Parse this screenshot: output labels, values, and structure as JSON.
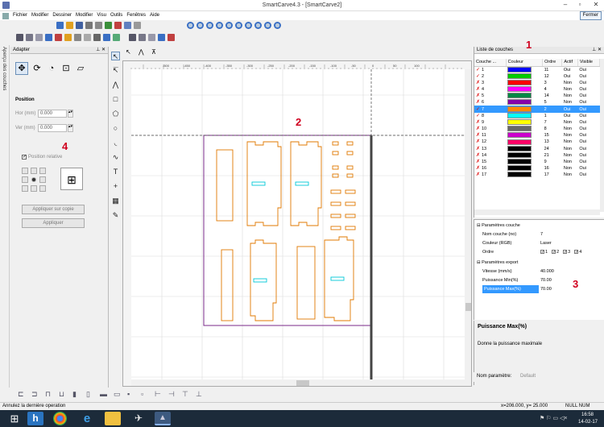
{
  "window": {
    "title": "SmartCarve4.3 - [SmartCarve2]",
    "close_label": "Fermer"
  },
  "menu": [
    "Fichier",
    "Modifier",
    "Dessiner",
    "Modifier",
    "Visu",
    "Outils",
    "Fenêtres",
    "Aide"
  ],
  "side_tab": "Aperçu des couches",
  "adapter": {
    "title": "Adapter",
    "section_position": "Position",
    "x_label": "Hor (mm)",
    "x_value": "0.000",
    "y_label": "Ver (mm)",
    "y_value": "0.000",
    "relative_label": "Position relative",
    "apply_copy_label": "Appliquer sur copie",
    "apply_label": "Appliquer"
  },
  "layers": {
    "title": "Liste de couches",
    "headers": [
      "Couche ...",
      "Couleur",
      "Ordre",
      "Actif",
      "Visible"
    ],
    "rows": [
      {
        "mark": "✓",
        "num": "1",
        "color": "#0000ff",
        "order": "11",
        "active": "Oui",
        "visible": "Oui"
      },
      {
        "mark": "✓",
        "num": "2",
        "color": "#00cc00",
        "order": "12",
        "active": "Oui",
        "visible": "Oui"
      },
      {
        "mark": "✗",
        "num": "3",
        "color": "#ff0000",
        "order": "3",
        "active": "Non",
        "visible": "Oui"
      },
      {
        "mark": "✗",
        "num": "4",
        "color": "#ff00ff",
        "order": "4",
        "active": "Non",
        "visible": "Oui"
      },
      {
        "mark": "✗",
        "num": "5",
        "color": "#008844",
        "order": "14",
        "active": "Non",
        "visible": "Oui"
      },
      {
        "mark": "✗",
        "num": "6",
        "color": "#8800aa",
        "order": "5",
        "active": "Non",
        "visible": "Oui"
      },
      {
        "mark": "✓",
        "num": "7",
        "color": "#ff8800",
        "order": "2",
        "active": "Oui",
        "visible": "Oui",
        "selected": true
      },
      {
        "mark": "✓",
        "num": "8",
        "color": "#00ffff",
        "order": "1",
        "active": "Oui",
        "visible": "Oui"
      },
      {
        "mark": "✗",
        "num": "9",
        "color": "#ffff00",
        "order": "7",
        "active": "Non",
        "visible": "Oui"
      },
      {
        "mark": "✗",
        "num": "10",
        "color": "#666666",
        "order": "8",
        "active": "Non",
        "visible": "Oui"
      },
      {
        "mark": "✗",
        "num": "11",
        "color": "#cc00cc",
        "order": "15",
        "active": "Non",
        "visible": "Oui"
      },
      {
        "mark": "✗",
        "num": "12",
        "color": "#ff0066",
        "order": "13",
        "active": "Non",
        "visible": "Oui"
      },
      {
        "mark": "✗",
        "num": "13",
        "color": "#000000",
        "order": "24",
        "active": "Non",
        "visible": "Oui"
      },
      {
        "mark": "✗",
        "num": "14",
        "color": "#000000",
        "order": "21",
        "active": "Non",
        "visible": "Oui"
      },
      {
        "mark": "✗",
        "num": "15",
        "color": "#000000",
        "order": "9",
        "active": "Non",
        "visible": "Oui"
      },
      {
        "mark": "✗",
        "num": "16",
        "color": "#000000",
        "order": "16",
        "active": "Non",
        "visible": "Oui"
      },
      {
        "mark": "✗",
        "num": "17",
        "color": "#000000",
        "order": "17",
        "active": "Non",
        "visible": "Oui"
      }
    ]
  },
  "props": {
    "section_layer": "Paramètres couche",
    "name_label": "Nom couche (no)",
    "name_value": "7",
    "color_label": "Couleur (RGB)",
    "color_value": "Laser",
    "order_label": "Ordre",
    "order_boxes": [
      "1",
      "2",
      "3",
      "4"
    ],
    "section_export": "Paramètres export",
    "speed_label": "Vitesse (mm/s)",
    "speed_value": "40.000",
    "pmin_label": "Puissance Min(%)",
    "pmin_value": "70.00",
    "pmax_label": "Puissance Max(%)",
    "pmax_value": "70.00"
  },
  "desc": {
    "title": "Puissance Max(%)",
    "text": "Donne la puissance maximale",
    "param_label": "Nom paramètre:",
    "param_value": "Default"
  },
  "status": {
    "left": "Annulez la dernière operation",
    "coords": "x=206.000, y= 25.000",
    "mode": "NULL NUM"
  },
  "taskbar": {
    "time": "16:58",
    "date": "14-02-17"
  },
  "annotations": [
    "1",
    "2",
    "3",
    "4"
  ],
  "ruler_labels": [
    "-500",
    "-450",
    "-400",
    "-350",
    "-300",
    "-250",
    "-200",
    "-150",
    "-100",
    "-50",
    "0",
    "50",
    "100"
  ],
  "colors": {
    "accent": "#3399ff",
    "canvas_shape": "#e07800",
    "marker": "#d0001e"
  }
}
